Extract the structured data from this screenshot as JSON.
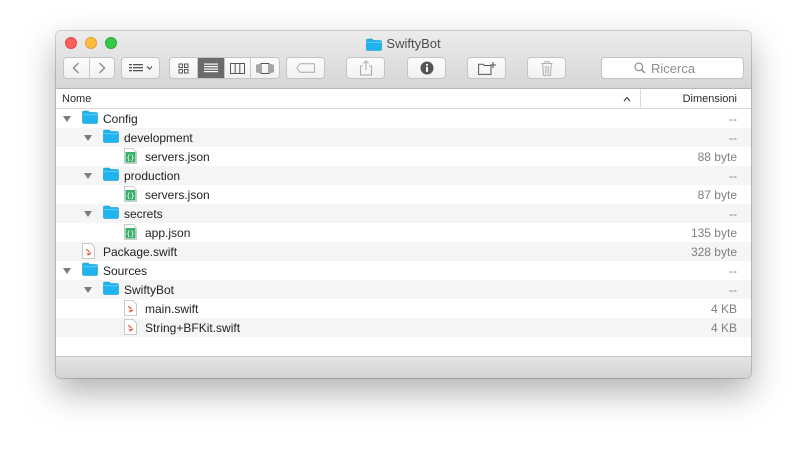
{
  "window": {
    "title": "SwiftyBot"
  },
  "toolbar": {
    "back_icon": "chevron-left-icon",
    "forward_icon": "chevron-right-icon",
    "arrange_icon": "arrange-menu-icon",
    "views": [
      "icon-view-icon",
      "list-view-icon",
      "column-view-icon",
      "coverflow-view-icon"
    ],
    "active_view": "list-view-icon",
    "tag_icon": "tag-icon",
    "share_icon": "share-icon",
    "info_icon": "info-icon",
    "new_folder_icon": "new-folder-icon",
    "trash_icon": "trash-icon",
    "search_placeholder": "Ricerca"
  },
  "columns": {
    "name": "Nome",
    "size": "Dimensioni"
  },
  "files": [
    {
      "name": "Config",
      "size": "--",
      "type": "folder",
      "depth": 0,
      "expanded": true
    },
    {
      "name": "development",
      "size": "--",
      "type": "folder",
      "depth": 1,
      "expanded": true
    },
    {
      "name": "servers.json",
      "size": "88 byte",
      "type": "json",
      "depth": 2
    },
    {
      "name": "production",
      "size": "--",
      "type": "folder",
      "depth": 1,
      "expanded": true
    },
    {
      "name": "servers.json",
      "size": "87 byte",
      "type": "json",
      "depth": 2
    },
    {
      "name": "secrets",
      "size": "--",
      "type": "folder",
      "depth": 1,
      "expanded": true
    },
    {
      "name": "app.json",
      "size": "135 byte",
      "type": "json",
      "depth": 2
    },
    {
      "name": "Package.swift",
      "size": "328 byte",
      "type": "swift",
      "depth": 0
    },
    {
      "name": "Sources",
      "size": "--",
      "type": "folder",
      "depth": 0,
      "expanded": true
    },
    {
      "name": "SwiftyBot",
      "size": "--",
      "type": "folder",
      "depth": 1,
      "expanded": true
    },
    {
      "name": "main.swift",
      "size": "4 KB",
      "type": "swift",
      "depth": 2
    },
    {
      "name": "String+BFKit.swift",
      "size": "4 KB",
      "type": "swift",
      "depth": 2
    }
  ],
  "colors": {
    "folder": "#1fb4ef",
    "json_icon": "#3bb06a",
    "swift_icon": "#f05138",
    "active_segment": "#6b6b6b"
  }
}
